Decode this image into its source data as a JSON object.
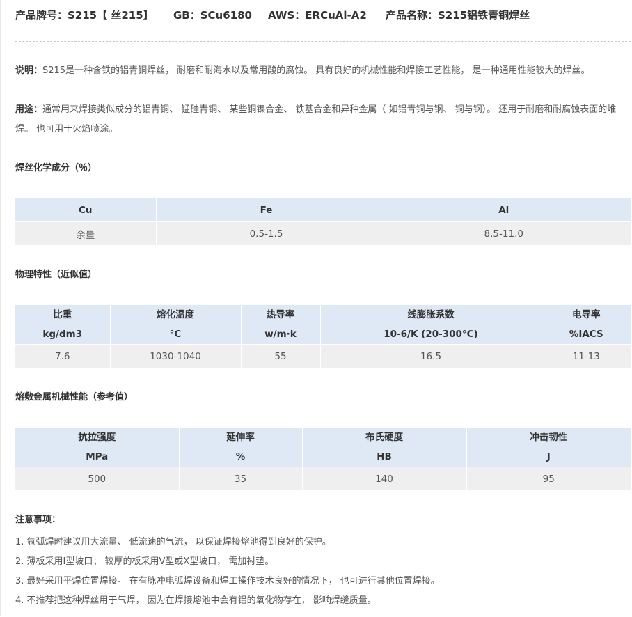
{
  "header": {
    "brand": "产品牌号：S215【 丝215】",
    "gb": "GB：SCu6180",
    "aws": "AWS：ERCuAl-A2",
    "name": "产品名称：S215铝铁青铜焊丝"
  },
  "description": {
    "label": "说明：",
    "text": "S215是一种含铁的铝青铜焊丝， 耐磨和耐海水以及常用酸的腐蚀。 具有良好的机械性能和焊接工艺性能， 是一种通用性能较大的焊丝。"
  },
  "usage": {
    "label": "用途：",
    "text": "通常用来焊接类似成分的铝青铜、 锰硅青铜、 某些铜镍合金、 铁基合金和异种金属（ 如铝青铜与钢、 铜与钢）。 还用于耐磨和耐腐蚀表面的堆焊。 也可用于火焰喷涂。"
  },
  "chemistry": {
    "title": "焊丝化学成分（％）",
    "headers": [
      "Cu",
      "Fe",
      "Al"
    ],
    "values": [
      "余量",
      "0.5-1.5",
      "8.5-11.0"
    ]
  },
  "physical": {
    "title": "物理特性（近似值）",
    "headers": [
      {
        "name": "比重",
        "unit": "kg/dm3"
      },
      {
        "name": "熔化温度",
        "unit": "°C"
      },
      {
        "name": "热导率",
        "unit": "w/m·k"
      },
      {
        "name": "线膨胀系数",
        "unit": "10-6/K (20-300°C)"
      },
      {
        "name": "电导率",
        "unit": "%IACS"
      }
    ],
    "values": [
      "7.6",
      "1030-1040",
      "55",
      "16.5",
      "11-13"
    ]
  },
  "mechanical": {
    "title": "熔敷金属机械性能（参考值）",
    "headers": [
      {
        "name": "抗拉强度",
        "unit": "MPa"
      },
      {
        "name": "延伸率",
        "unit": "%"
      },
      {
        "name": "布氏硬度",
        "unit": "HB"
      },
      {
        "name": "冲击韧性",
        "unit": "J"
      }
    ],
    "values": [
      "500",
      "35",
      "140",
      "95"
    ]
  },
  "notes": {
    "title": "注意事项：",
    "items": [
      "1. 氩弧焊时建议用大流量、 低流速的气流， 以保证焊接熔池得到良好的保护。",
      "2. 薄板采用I型坡口； 较厚的板采用V型或X型坡口， 需加衬垫。",
      "3. 最好采用平焊位置焊接。 在有脉冲电弧焊设备和焊工操作技术良好的情况下， 也可进行其他位置焊接。",
      "4. 不推荐把这种焊丝用于气焊， 因为在焊接熔池中会有铝的氧化物存在， 影响焊缝质量。"
    ]
  }
}
